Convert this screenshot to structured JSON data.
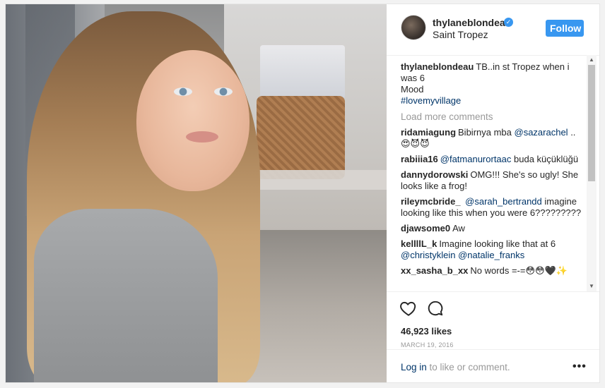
{
  "post": {
    "username": "thylaneblondeau",
    "location": "Saint Tropez",
    "follow_label": "Follow",
    "caption": {
      "user": "thylaneblondeau",
      "text_line1": "TB..in st Tropez when i",
      "text_line2": "was 6",
      "text_line3": "Mood",
      "hashtag": "#lovemyvillage"
    },
    "load_more": "Load more comments",
    "comments": [
      {
        "user": "ridamiagung",
        "pre": "Bibirnya mba ",
        "mention": "@sazarachel",
        "post": " .. 😍😈😈"
      },
      {
        "user": "rabiiia16",
        "pre": "",
        "mention": "@fatmanurortaac",
        "post": " buda küçüklüğü"
      },
      {
        "user": "dannydorowski",
        "pre": "OMG!!! She's so ugly! She looks like a frog!",
        "mention": "",
        "post": ""
      },
      {
        "user": "rileymcbride_",
        "pre": " ",
        "mention": "@sarah_bertrandd",
        "post": " imagine looking like this when you were 6?????????"
      },
      {
        "user": "djawsome0",
        "pre": "Aw",
        "mention": "",
        "post": ""
      },
      {
        "user": "kellllL_k",
        "pre": "Imagine looking like that at 6 ",
        "mention": "@christyklein @natalie_franks",
        "post": ""
      },
      {
        "user": "xx_sasha_b_xx",
        "pre": "No words =-=😳😳🖤✨",
        "mention": "",
        "post": ""
      }
    ],
    "likes": "46,923 likes",
    "date": "MARCH 19, 2016",
    "login_link": "Log in",
    "login_rest": " to like or comment.",
    "more_label": "•••"
  },
  "icons": {
    "heart": "heart-icon",
    "comment": "comment-bubble-icon",
    "verified": "verified-badge-icon",
    "more": "more-options-icon"
  },
  "colors": {
    "accent": "#3897f0",
    "link": "#003569",
    "muted": "#999999"
  }
}
